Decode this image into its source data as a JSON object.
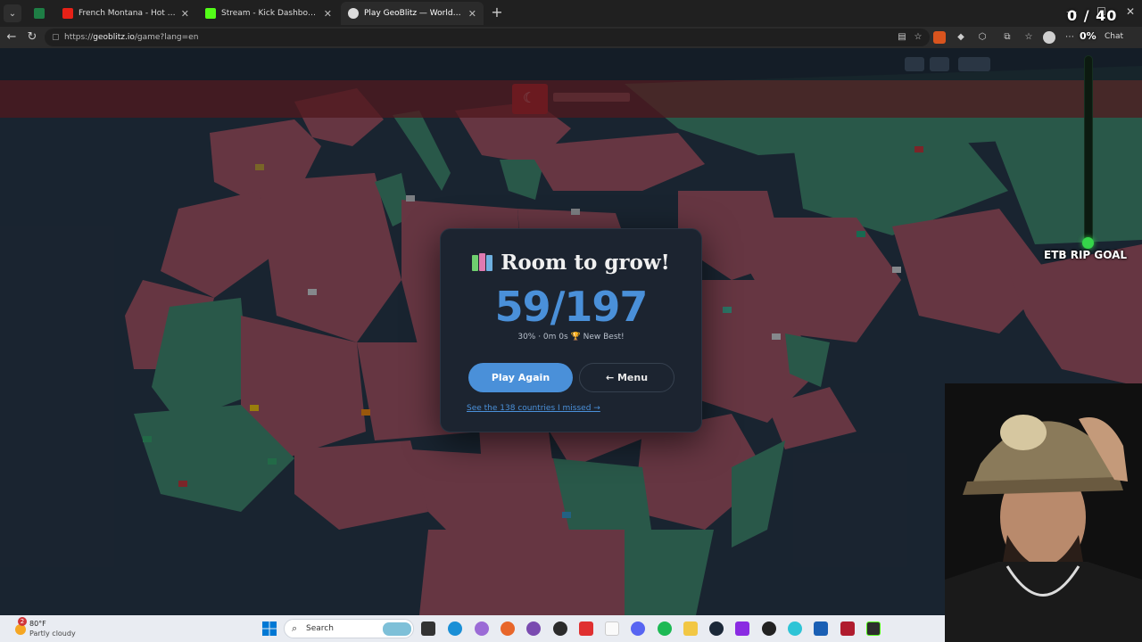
{
  "tabs": [
    {
      "title": "",
      "favicon_color": "#1e7e45",
      "active": false
    },
    {
      "title": "French Montana - Hot Boy Bling ft",
      "favicon_color": "#e62117",
      "active": false
    },
    {
      "title": "Stream - Kick Dashboard",
      "favicon_color": "#53fc18",
      "active": false
    },
    {
      "title": "Play GeoBlitz — World Geography",
      "favicon_color": "#dcdcdc",
      "active": true
    }
  ],
  "address": {
    "prefix": "https://",
    "host": "geoblitz.io",
    "path": "/game?lang=en"
  },
  "browser": {
    "chat_label": "Chat"
  },
  "overlay": {
    "counter": "0 / 40",
    "percent": "0%",
    "goal_label": "ETB RIP GOAL",
    "goal_progress": 0.04
  },
  "modal": {
    "title": "Room to grow!",
    "score": "59/197",
    "subtitle": "30% · 0m 0s 🏆 New Best!",
    "play_again": "Play Again",
    "menu": "← Menu",
    "missed_link": "See the 138 countries I missed →"
  },
  "taskbar": {
    "temperature": "80°F",
    "condition": "Partly cloudy",
    "search_label": "Search",
    "notification_count": "2"
  },
  "colors": {
    "accent": "#4a90d9",
    "missed_country": "#a8505e",
    "found_country": "#3f8a6a",
    "ocean": "#24313f"
  }
}
